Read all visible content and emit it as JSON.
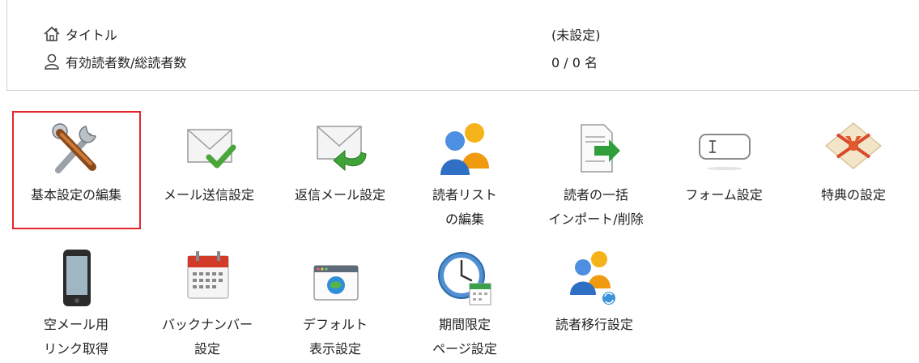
{
  "info": {
    "title_label": "タイトル",
    "title_value": "(未設定)",
    "readers_label": "有効読者数/総読者数",
    "readers_value": "0 / 0 名",
    "title_icon": "home-icon",
    "readers_icon": "user-icon"
  },
  "tiles_row1": [
    {
      "label": "基本設定の編集",
      "icon": "tools-icon",
      "selected": true
    },
    {
      "label": "メール送信設定",
      "icon": "mail-check-icon"
    },
    {
      "label": "返信メール設定",
      "icon": "mail-reply-icon"
    },
    {
      "label": "読者リスト\nの編集",
      "icon": "users-icon"
    },
    {
      "label": "読者の一括\nインポート/削除",
      "icon": "import-icon"
    },
    {
      "label": "フォーム設定",
      "icon": "form-icon"
    },
    {
      "label": "特典の設定",
      "icon": "gift-icon"
    }
  ],
  "tiles_row2": [
    {
      "label": "空メール用\nリンク取得",
      "icon": "phone-icon"
    },
    {
      "label": "バックナンバー\n設定",
      "icon": "calendar-icon"
    },
    {
      "label": "デフォルト\n表示設定",
      "icon": "browser-icon"
    },
    {
      "label": "期間限定\nページ設定",
      "icon": "clock-calendar-icon"
    },
    {
      "label": "読者移行設定",
      "icon": "users-transfer-icon"
    }
  ],
  "colors": {
    "selection_border": "#e5262b"
  }
}
